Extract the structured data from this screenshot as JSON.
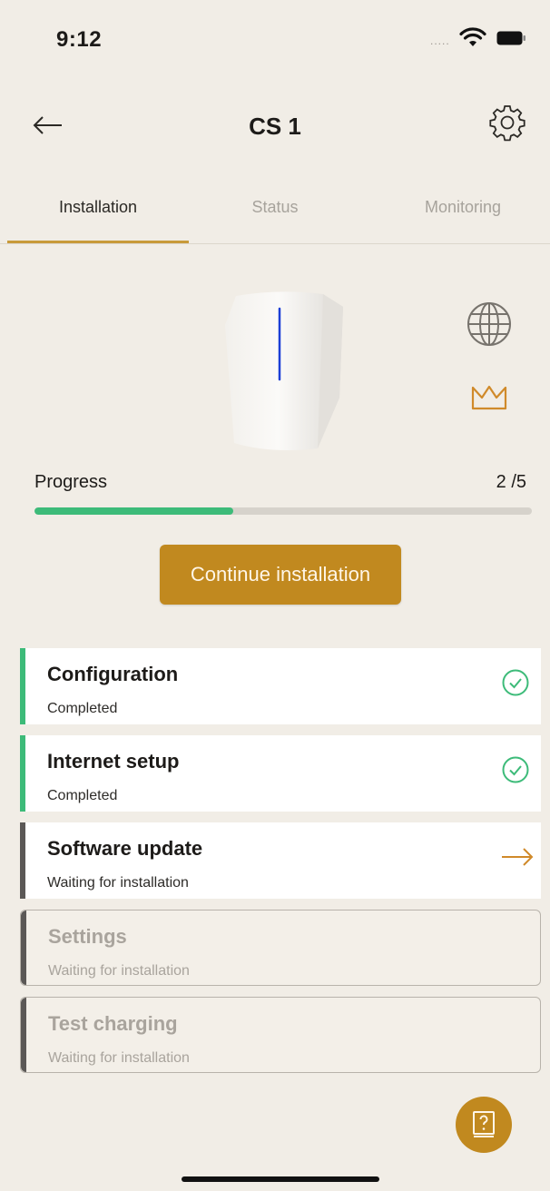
{
  "status_bar": {
    "time": "9:12",
    "signal": "....."
  },
  "header": {
    "title": "CS 1",
    "back_icon": "arrow-left-icon",
    "settings_icon": "gear-icon"
  },
  "tabs": [
    {
      "label": "Installation",
      "active": true
    },
    {
      "label": "Status",
      "active": false
    },
    {
      "label": "Monitoring",
      "active": false
    }
  ],
  "charger": {
    "icons": [
      "globe-icon",
      "crown-icon"
    ]
  },
  "progress": {
    "label": "Progress",
    "value_text": "2 /5",
    "completed": 2,
    "total": 5
  },
  "continue_button": {
    "label": "Continue installation"
  },
  "steps": [
    {
      "title": "Configuration",
      "status": "Completed",
      "state": "completed"
    },
    {
      "title": "Internet setup",
      "status": "Completed",
      "state": "completed"
    },
    {
      "title": "Software update",
      "status": "Waiting for installation",
      "state": "current"
    },
    {
      "title": "Settings",
      "status": "Waiting for installation",
      "state": "disabled"
    },
    {
      "title": "Test charging",
      "status": "Waiting for installation",
      "state": "disabled"
    }
  ],
  "colors": {
    "background": "#f1ede6",
    "accent": "#c1891f",
    "progress_green": "#3dbb79",
    "tab_indicator": "#c89a3a",
    "current_step_bar": "#5b5856"
  },
  "fab": {
    "icon": "manual-help-icon"
  }
}
